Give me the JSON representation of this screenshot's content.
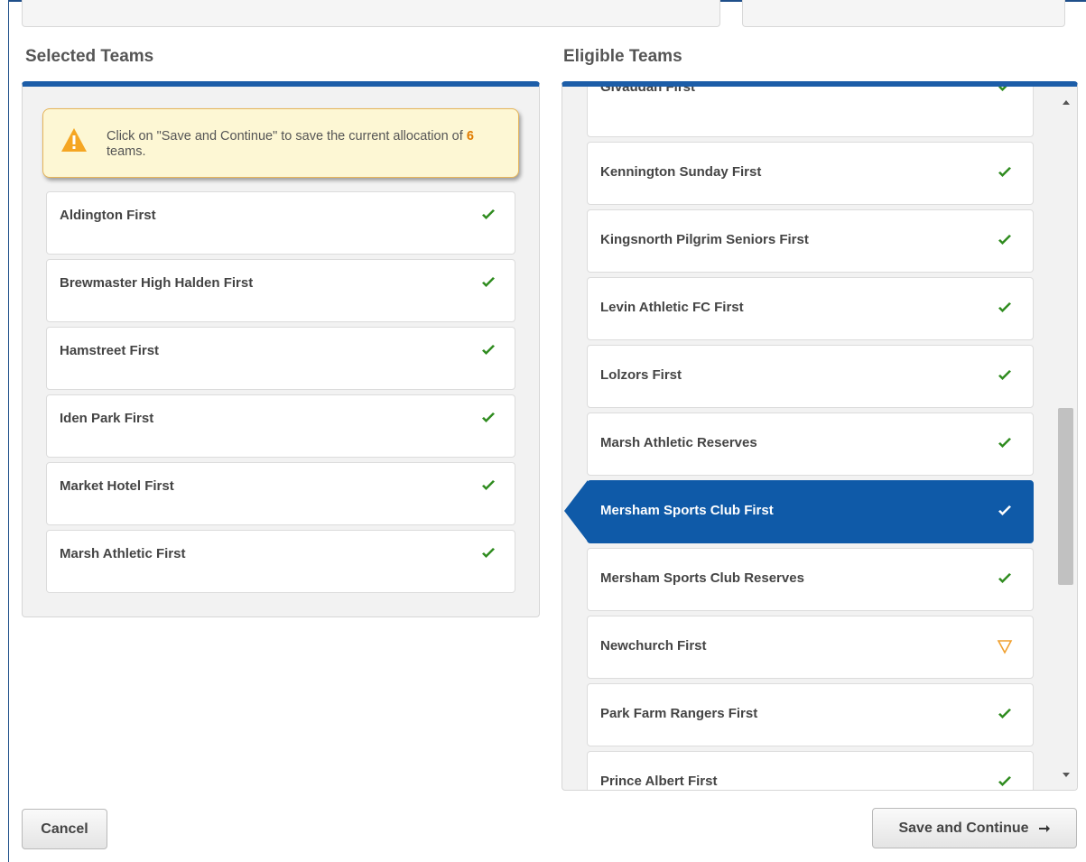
{
  "selected": {
    "title": "Selected Teams",
    "alert": {
      "text_before": "Click on \"Save and Continue\" to save the current allocation of ",
      "count": "6",
      "text_after": " teams."
    },
    "teams": [
      {
        "name": "Aldington First",
        "status": "ok"
      },
      {
        "name": "Brewmaster High Halden First",
        "status": "ok"
      },
      {
        "name": "Hamstreet First",
        "status": "ok"
      },
      {
        "name": "Iden Park First",
        "status": "ok"
      },
      {
        "name": "Market Hotel First",
        "status": "ok"
      },
      {
        "name": "Marsh Athletic First",
        "status": "ok"
      }
    ]
  },
  "eligible": {
    "title": "Eligible Teams",
    "teams": [
      {
        "name": "Givaudan First",
        "status": "ok"
      },
      {
        "name": "Kennington Sunday First",
        "status": "ok"
      },
      {
        "name": "Kingsnorth Pilgrim Seniors First",
        "status": "ok"
      },
      {
        "name": "Levin Athletic FC First",
        "status": "ok"
      },
      {
        "name": "Lolzors First",
        "status": "ok"
      },
      {
        "name": "Marsh Athletic Reserves",
        "status": "ok"
      },
      {
        "name": "Mersham Sports Club First",
        "status": "ok",
        "selected": true
      },
      {
        "name": "Mersham Sports Club Reserves",
        "status": "ok"
      },
      {
        "name": "Newchurch First",
        "status": "warning"
      },
      {
        "name": "Park Farm Rangers First",
        "status": "ok"
      },
      {
        "name": "Prince Albert First",
        "status": "ok"
      }
    ]
  },
  "buttons": {
    "cancel": "Cancel",
    "save": "Save and Continue"
  },
  "icons": {
    "ok": "check-icon",
    "warning": "warning-triangle-icon",
    "alert": "alert-icon",
    "arrow": "arrow-right-icon"
  },
  "colors": {
    "accent": "#1c5da8",
    "selected_row": "#0f5aa8",
    "check": "#2e8b1e",
    "warning": "#f0a030",
    "count": "#e07b00"
  }
}
